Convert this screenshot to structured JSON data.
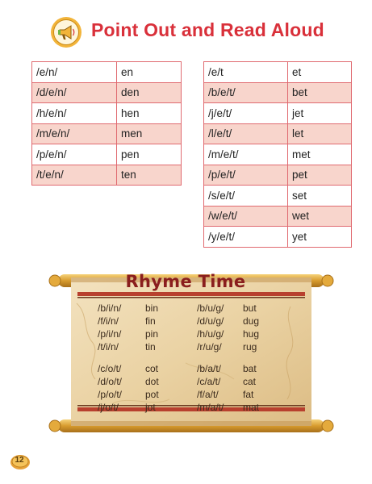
{
  "title": "Point Out and Read Aloud",
  "icons": {
    "title_icon": "megaphone-icon",
    "page_badge": "coin-badge-icon"
  },
  "colors": {
    "title": "#d9303a",
    "table_border": "#e06a70",
    "table_stripe": "#f8d5cc",
    "scroll_title": "#8a1e1e"
  },
  "table_en": [
    [
      "/e/n/",
      "en"
    ],
    [
      "/d/e/n/",
      "den"
    ],
    [
      "/h/e/n/",
      "hen"
    ],
    [
      "/m/e/n/",
      "men"
    ],
    [
      "/p/e/n/",
      "pen"
    ],
    [
      "/t/e/n/",
      "ten"
    ]
  ],
  "table_et": [
    [
      "/e/t",
      "et"
    ],
    [
      "/b/e/t/",
      "bet"
    ],
    [
      "/j/e/t/",
      "jet"
    ],
    [
      "/l/e/t/",
      "let"
    ],
    [
      "/m/e/t/",
      "met"
    ],
    [
      "/p/e/t/",
      "pet"
    ],
    [
      "/s/e/t/",
      "set"
    ],
    [
      "/w/e/t/",
      "wet"
    ],
    [
      "/y/e/t/",
      "yet"
    ]
  ],
  "rhyme_time": {
    "title": "Rhyme Time",
    "groups": [
      {
        "left": [
          [
            "/b/i/n/",
            "bin"
          ],
          [
            "/f/i/n/",
            "fin"
          ],
          [
            "/p/i/n/",
            "pin"
          ],
          [
            "/t/i/n/",
            "tin"
          ]
        ],
        "right": [
          [
            "/b/u/g/",
            "but"
          ],
          [
            "/d/u/g/",
            "dug"
          ],
          [
            "/h/u/g/",
            "hug"
          ],
          [
            "/r/u/g/",
            "rug"
          ]
        ]
      },
      {
        "left": [
          [
            "/c/o/t/",
            "cot"
          ],
          [
            "/d/o/t/",
            "dot"
          ],
          [
            "/p/o/t/",
            "pot"
          ],
          [
            "/j/o/t/",
            "jot"
          ]
        ],
        "right": [
          [
            "/b/a/t/",
            "bat"
          ],
          [
            "/c/a/t/",
            "cat"
          ],
          [
            "/f/a/t/",
            "fat"
          ],
          [
            "/m/a/t/",
            "mat"
          ]
        ]
      }
    ]
  },
  "page_number": "12"
}
